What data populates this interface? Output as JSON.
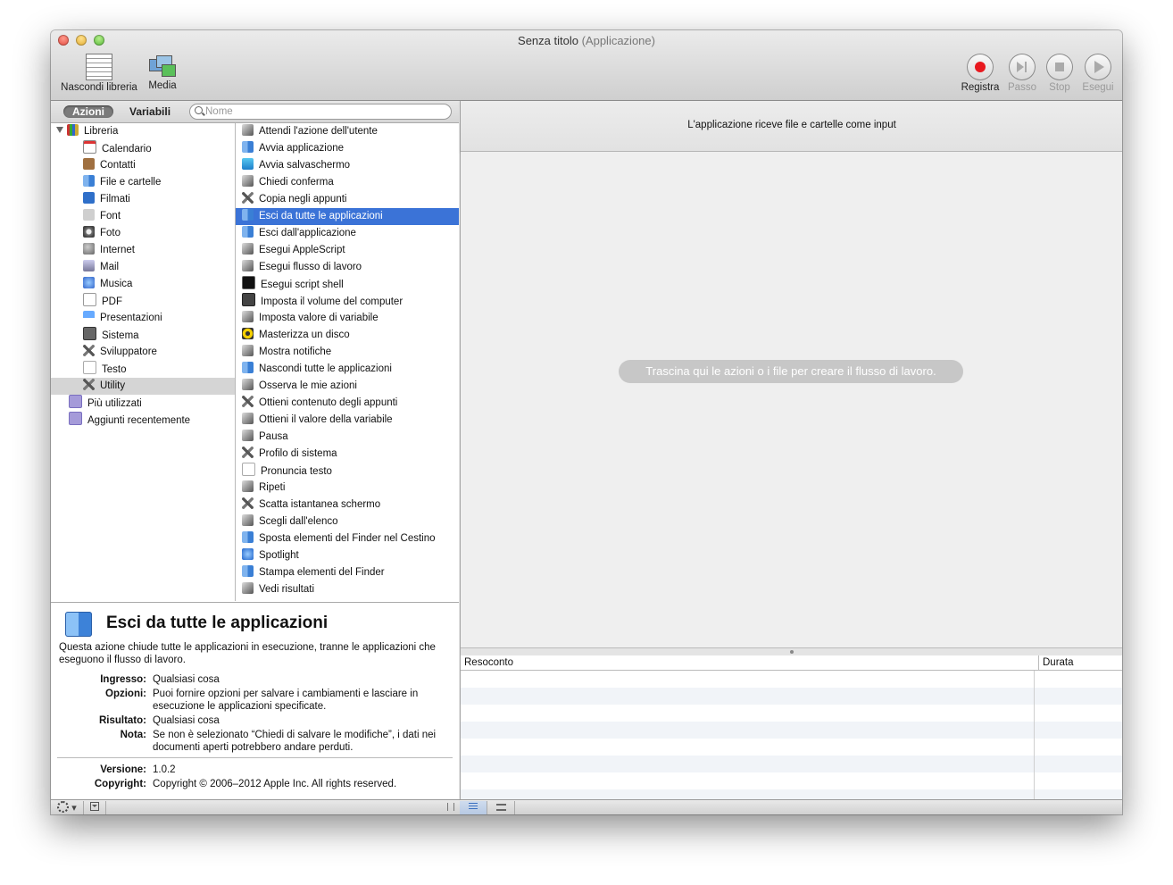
{
  "window": {
    "title": "Senza titolo",
    "title_sub": "(Applicazione)"
  },
  "toolbar": {
    "library_label": "Nascondi libreria",
    "media_label": "Media",
    "record_label": "Registra",
    "step_label": "Passo",
    "stop_label": "Stop",
    "run_label": "Esegui"
  },
  "filter": {
    "actions_tab": "Azioni",
    "variables_tab": "Variabili",
    "search_placeholder": "Nome"
  },
  "library": {
    "root": "Libreria",
    "items": [
      {
        "label": "Calendario",
        "icon": "calendar-icon"
      },
      {
        "label": "Contatti",
        "icon": "contacts-icon"
      },
      {
        "label": "File e cartelle",
        "icon": "finder-icon"
      },
      {
        "label": "Filmati",
        "icon": "quicktime-icon"
      },
      {
        "label": "Font",
        "icon": "font-icon"
      },
      {
        "label": "Foto",
        "icon": "camera-icon"
      },
      {
        "label": "Internet",
        "icon": "globe-icon"
      },
      {
        "label": "Mail",
        "icon": "mail-icon"
      },
      {
        "label": "Musica",
        "icon": "music-icon"
      },
      {
        "label": "PDF",
        "icon": "pdf-icon"
      },
      {
        "label": "Presentazioni",
        "icon": "presentation-icon"
      },
      {
        "label": "Sistema",
        "icon": "system-icon"
      },
      {
        "label": "Sviluppatore",
        "icon": "tools-icon"
      },
      {
        "label": "Testo",
        "icon": "text-icon"
      },
      {
        "label": "Utility",
        "icon": "utility-icon"
      }
    ],
    "selected": "Utility",
    "extra": [
      {
        "label": "Più utilizzati",
        "icon": "smart-folder-icon"
      },
      {
        "label": "Aggiunti recentemente",
        "icon": "smart-folder-icon"
      }
    ]
  },
  "actions": {
    "items": [
      "Attendi l'azione dell'utente",
      "Avvia applicazione",
      "Avvia salvaschermo",
      "Chiedi conferma",
      "Copia negli appunti",
      "Esci da tutte le applicazioni",
      "Esci dall'applicazione",
      "Esegui AppleScript",
      "Esegui flusso di lavoro",
      "Esegui script shell",
      "Imposta il volume del computer",
      "Imposta valore di variabile",
      "Masterizza un disco",
      "Mostra notifiche",
      "Nascondi tutte le applicazioni",
      "Osserva le mie azioni",
      "Ottieni contenuto degli appunti",
      "Ottieni il valore della variabile",
      "Pausa",
      "Profilo di sistema",
      "Pronuncia testo",
      "Ripeti",
      "Scatta istantanea schermo",
      "Scegli dall'elenco",
      "Sposta elementi del Finder nel Cestino",
      "Spotlight",
      "Stampa elementi del Finder",
      "Vedi risultati"
    ],
    "selected": "Esci da tutte le applicazioni"
  },
  "description": {
    "title": "Esci da tutte le applicazioni",
    "text": "Questa azione chiude tutte le applicazioni in esecuzione, tranne le applicazioni che eseguono il flusso di lavoro.",
    "input_label": "Ingresso:",
    "input_value": "Qualsiasi cosa",
    "options_label": "Opzioni:",
    "options_value": "Puoi fornire opzioni per salvare i cambiamenti e lasciare in esecuzione le applicazioni specificate.",
    "result_label": "Risultato:",
    "result_value": "Qualsiasi cosa",
    "note_label": "Nota:",
    "note_value": "Se non è selezionato “Chiedi di salvare le modifiche”, i dati nei documenti aperti potrebbero andare perduti.",
    "version_label": "Versione:",
    "version_value": "1.0.2",
    "copyright_label": "Copyright:",
    "copyright_value": "Copyright © 2006–2012 Apple Inc.  All rights reserved."
  },
  "workflow": {
    "input_header": "L'applicazione riceve file e cartelle come input",
    "drop_hint": "Trascina qui le azioni o i file per creare il flusso di lavoro."
  },
  "log": {
    "col_report": "Resoconto",
    "col_duration": "Durata"
  }
}
